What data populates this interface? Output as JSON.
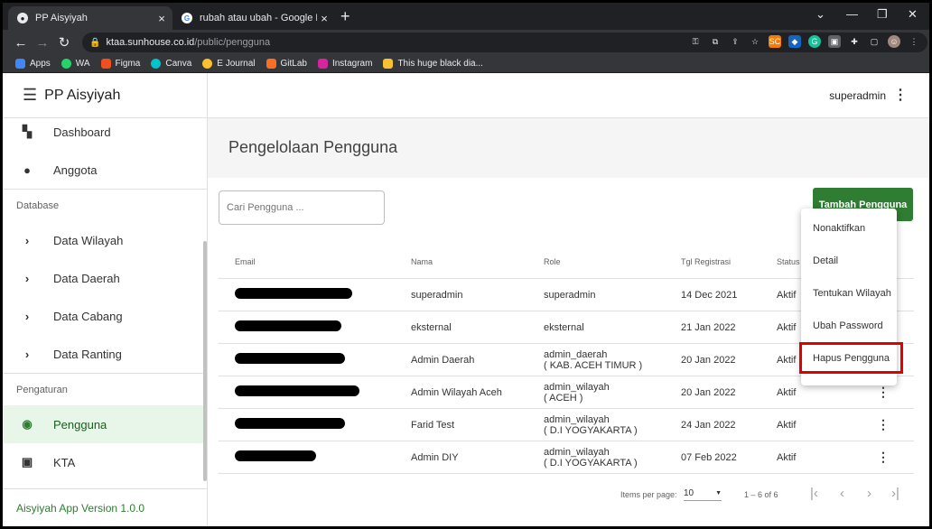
{
  "browser": {
    "tabs": [
      {
        "title": "PP Aisyiyah",
        "active": true
      },
      {
        "title": "rubah atau ubah - Google Nggol",
        "active": false
      }
    ],
    "url_host": "ktaa.sunhouse.co.id",
    "url_path": "/public/pengguna",
    "bookmarks": [
      "Apps",
      "WA",
      "Figma",
      "Canva",
      "E Journal",
      "GitLab",
      "Instagram",
      "This huge black dia..."
    ],
    "extension_icons": [
      "key-icon",
      "translate-icon",
      "share-icon",
      "star-icon",
      "sc-icon",
      "shield-icon",
      "grammarly-icon",
      "ext-icon",
      "puzzle-icon",
      "window-icon",
      "avatar-icon",
      "more-icon"
    ]
  },
  "app": {
    "name": "PP Aisyiyah",
    "user": "superadmin",
    "version": "Aisyiyah App Version 1.0.0",
    "accent": "#2e7d32"
  },
  "sidebar": {
    "top_items": [
      {
        "label": "Dashboard",
        "icon": "dashboard-icon"
      },
      {
        "label": "Anggota",
        "icon": "person-icon"
      }
    ],
    "database_label": "Database",
    "database_items": [
      "Data Wilayah",
      "Data Daerah",
      "Data Cabang",
      "Data Ranting"
    ],
    "settings_label": "Pengaturan",
    "settings_items": [
      {
        "label": "Pengguna",
        "icon": "account-circle-icon",
        "active": true
      },
      {
        "label": "KTA",
        "icon": "badge-icon",
        "active": false
      }
    ]
  },
  "page": {
    "title": "Pengelolaan Pengguna",
    "search_placeholder": "Cari Pengguna ...",
    "add_button": "Tambah Pengguna"
  },
  "table": {
    "headers": [
      "Email",
      "Nama",
      "Role",
      "Tgl Registrasi",
      "Status"
    ],
    "rows": [
      {
        "email": "",
        "nama": "superadmin",
        "role": "superadmin",
        "role_sub": "",
        "tgl": "14 Dec 2021",
        "status": "Aktif"
      },
      {
        "email": "",
        "nama": "eksternal",
        "role": "eksternal",
        "role_sub": "",
        "tgl": "21 Jan 2022",
        "status": "Aktif"
      },
      {
        "email": "",
        "nama": "Admin Daerah",
        "role": "admin_daerah",
        "role_sub": "( KAB. ACEH TIMUR )",
        "tgl": "20 Jan 2022",
        "status": "Aktif"
      },
      {
        "email": "",
        "nama": "Admin Wilayah Aceh",
        "role": "admin_wilayah",
        "role_sub": "( ACEH )",
        "tgl": "20 Jan 2022",
        "status": "Aktif"
      },
      {
        "email": "",
        "nama": "Farid Test",
        "role": "admin_wilayah",
        "role_sub": "( D.I YOGYAKARTA )",
        "tgl": "24 Jan 2022",
        "status": "Aktif"
      },
      {
        "email": "",
        "nama": "Admin DIY",
        "role": "admin_wilayah",
        "role_sub": "( D.I YOGYAKARTA )",
        "tgl": "07 Feb 2022",
        "status": "Aktif"
      }
    ]
  },
  "pagination": {
    "items_per_page_label": "Items per page:",
    "items_per_page": "10",
    "range": "1 – 6 of 6"
  },
  "context_menu": {
    "items": [
      "Nonaktifkan",
      "Detail",
      "Tentukan Wilayah",
      "Ubah Password",
      "Hapus Pengguna"
    ],
    "highlighted": "Hapus Pengguna"
  }
}
